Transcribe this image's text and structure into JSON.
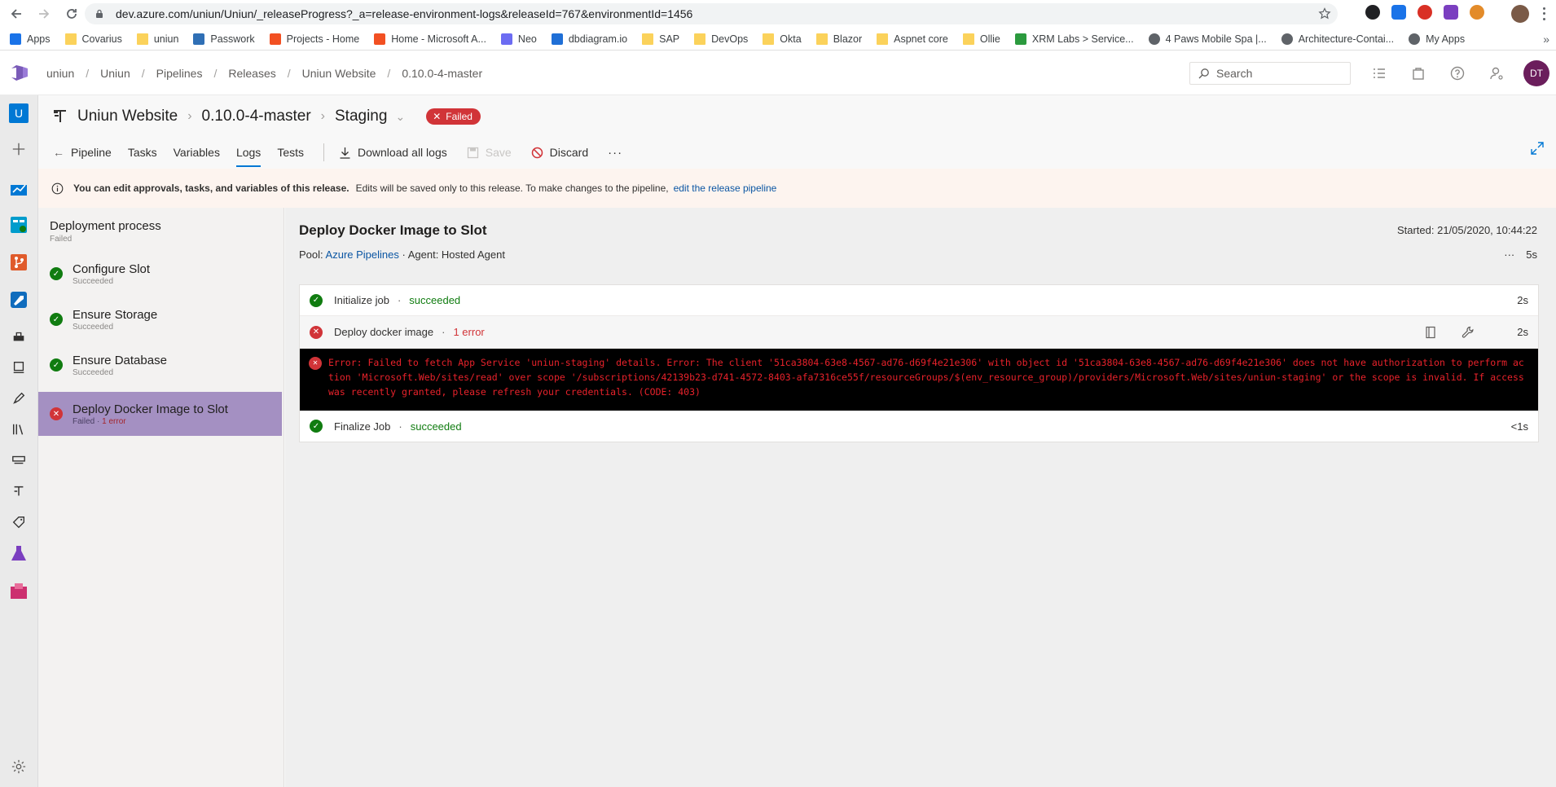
{
  "browser": {
    "url": "dev.azure.com/uniun/Uniun/_releaseProgress?_a=release-environment-logs&releaseId=767&environmentId=1456",
    "bookmarks": [
      {
        "label": "Apps",
        "icon": "apps-grid-icon",
        "color": "#1a73e8"
      },
      {
        "label": "Covarius",
        "icon": "folder-icon",
        "color": "#fbd25b"
      },
      {
        "label": "uniun",
        "icon": "folder-icon",
        "color": "#fbd25b"
      },
      {
        "label": "Passwork",
        "icon": "key-icon",
        "color": "#2f6fb5"
      },
      {
        "label": "Projects - Home",
        "icon": "microsoft-icon",
        "color": "#f25022"
      },
      {
        "label": "Home - Microsoft A...",
        "icon": "microsoft-icon",
        "color": "#f25022"
      },
      {
        "label": "Neo",
        "icon": "neo-icon",
        "color": "#6c6cf2"
      },
      {
        "label": "dbdiagram.io",
        "icon": "dbdiagram-icon",
        "color": "#1f6fd6"
      },
      {
        "label": "SAP",
        "icon": "folder-icon",
        "color": "#fbd25b"
      },
      {
        "label": "DevOps",
        "icon": "folder-icon",
        "color": "#fbd25b"
      },
      {
        "label": "Okta",
        "icon": "folder-icon",
        "color": "#fbd25b"
      },
      {
        "label": "Blazor",
        "icon": "folder-icon",
        "color": "#fbd25b"
      },
      {
        "label": "Aspnet core",
        "icon": "folder-icon",
        "color": "#fbd25b"
      },
      {
        "label": "Ollie",
        "icon": "folder-icon",
        "color": "#fbd25b"
      },
      {
        "label": "XRM Labs > Service...",
        "icon": "flask-icon",
        "color": "#2b9a3e"
      },
      {
        "label": "4 Paws Mobile Spa |...",
        "icon": "globe-icon",
        "color": "#5f6368"
      },
      {
        "label": "Architecture-Contai...",
        "icon": "globe-icon",
        "color": "#5f6368"
      },
      {
        "label": "My Apps",
        "icon": "globe-icon",
        "color": "#5f6368"
      }
    ]
  },
  "header": {
    "breadcrumb": [
      "uniun",
      "Uniun",
      "Pipelines",
      "Releases",
      "Uniun Website",
      "0.10.0-4-master"
    ],
    "search_placeholder": "Search",
    "avatar_initials": "DT"
  },
  "rail": {
    "project_initial": "U"
  },
  "release": {
    "pipeline_name": "Uniun Website",
    "release_name": "0.10.0-4-master",
    "stage_name": "Staging",
    "status": "Failed",
    "tabs": {
      "pipeline": "Pipeline",
      "tasks": "Tasks",
      "variables": "Variables",
      "logs": "Logs",
      "tests": "Tests"
    },
    "actions": {
      "download": "Download all logs",
      "save": "Save",
      "discard": "Discard",
      "more": "···"
    }
  },
  "banner": {
    "bold_text": "You can edit approvals, tasks, and variables of this release.",
    "text": "Edits will be saved only to this release. To make changes to the pipeline,",
    "link": "edit the release pipeline"
  },
  "process": {
    "title": "Deployment process",
    "status": "Failed",
    "steps": [
      {
        "name": "Configure Slot",
        "status": "Succeeded",
        "error": ""
      },
      {
        "name": "Ensure Storage",
        "status": "Succeeded",
        "error": ""
      },
      {
        "name": "Ensure Database",
        "status": "Succeeded",
        "error": ""
      },
      {
        "name": "Deploy Docker Image to Slot",
        "status": "Failed",
        "error": "1 error"
      }
    ]
  },
  "job": {
    "title": "Deploy Docker Image to Slot",
    "pool_label": "Pool:",
    "pool_link": "Azure Pipelines",
    "agent": "· Agent: Hosted Agent",
    "started": "Started: 21/05/2020, 10:44:22",
    "more": "···",
    "duration": "5s",
    "steps": [
      {
        "name": "Initialize job",
        "dot": "·",
        "result": "succeeded",
        "duration": "2s"
      },
      {
        "name": "Deploy docker image",
        "dot": "·",
        "result": "1 error",
        "duration": "2s"
      },
      {
        "name": "Finalize Job",
        "dot": "·",
        "result": "succeeded",
        "duration": "<1s"
      }
    ],
    "error_message": "Error: Failed to fetch App Service 'uniun-staging' details. Error: The client '51ca3804-63e8-4567-ad76-d69f4e21e306' with object id '51ca3804-63e8-4567-ad76-d69f4e21e306' does not have authorization to perform action 'Microsoft.Web/sites/read' over scope '/subscriptions/42139b23-d741-4572-8403-afa7316ce55f/resourceGroups/$(env_resource_group)/providers/Microsoft.Web/sites/uniun-staging' or the scope is invalid. If access was recently granted, please refresh your credentials. (CODE: 403)"
  },
  "colors": {
    "accent": "#0078d4",
    "failed": "#d13438",
    "succeeded": "#107c10",
    "selected_step": "#a490c2",
    "error_console_bg": "#000000",
    "error_console_text": "#e8222b"
  }
}
